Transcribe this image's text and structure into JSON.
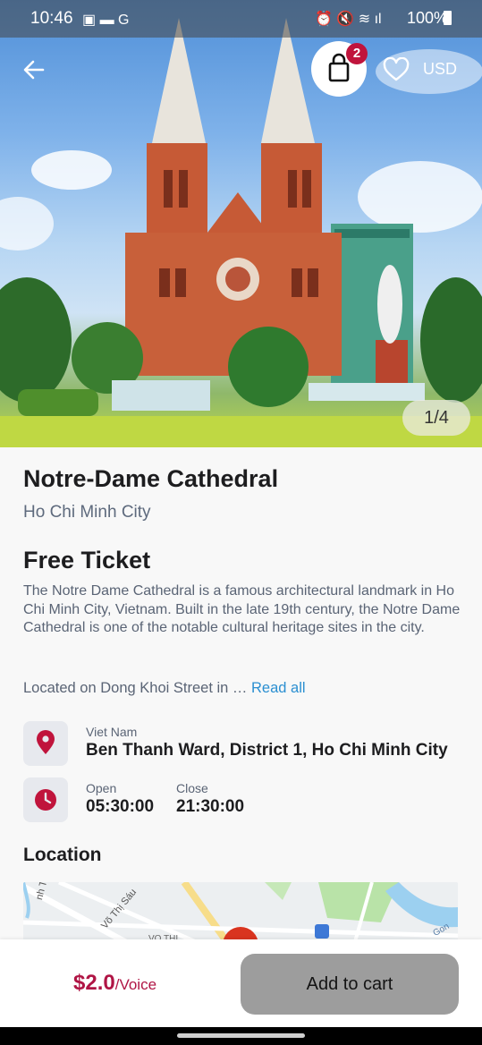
{
  "status_bar": {
    "time": "10:46",
    "battery": "100%"
  },
  "header": {
    "cart_count": "2",
    "currency": "USD"
  },
  "gallery": {
    "counter": "1/4"
  },
  "place": {
    "name": "Notre-Dame Cathedral",
    "city": "Ho Chi Minh City",
    "ticket_title": "Free Ticket",
    "description": "The Notre Dame Cathedral is a famous architectural landmark in Ho Chi Minh City, Vietnam. Built in the late 19th century, the Notre Dame Cathedral is one of the notable cultural heritage sites in the city.",
    "located_text": "Located on Dong Khoi Street in …",
    "read_all": "Read all"
  },
  "address": {
    "country": "Viet Nam",
    "line": "Ben Thanh Ward, District 1, Ho Chi Minh City"
  },
  "hours": {
    "open_label": "Open",
    "open_time": "05:30:00",
    "close_label": "Close",
    "close_time": "21:30:00"
  },
  "location": {
    "title": "Location",
    "map_labels": [
      "nh Thắng",
      "Võ Thị Sáu",
      "VO THI",
      "Gon"
    ]
  },
  "footer": {
    "price": "$2.0",
    "unit": "/Voice",
    "add_to_cart": "Add to cart"
  },
  "colors": {
    "accent": "#b01545",
    "link": "#2b8fd1",
    "button_disabled": "#9d9d9d"
  }
}
